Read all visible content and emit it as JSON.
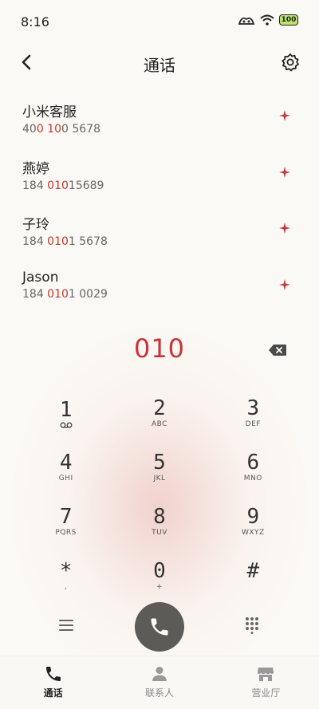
{
  "status": {
    "time": "8:16",
    "battery": "100"
  },
  "header": {
    "title": "通话"
  },
  "contacts": [
    {
      "name": "小米客服",
      "num_pre": "40",
      "num_hl": "0 10",
      "num_post": "0 5678"
    },
    {
      "name": "燕婷",
      "num_pre": "184 ",
      "num_hl": "010",
      "num_post": "15689"
    },
    {
      "name": "子玲",
      "num_pre": "184 ",
      "num_hl": "010",
      "num_post": "1 5678"
    },
    {
      "name": "Jason",
      "num_pre": "184 ",
      "num_hl": "010",
      "num_post": "1 0029"
    }
  ],
  "dialed": "010",
  "keypad": [
    {
      "digit": "1",
      "letters": ""
    },
    {
      "digit": "2",
      "letters": "ABC"
    },
    {
      "digit": "3",
      "letters": "DEF"
    },
    {
      "digit": "4",
      "letters": "GHI"
    },
    {
      "digit": "5",
      "letters": "JKL"
    },
    {
      "digit": "6",
      "letters": "MNO"
    },
    {
      "digit": "7",
      "letters": "PQRS"
    },
    {
      "digit": "8",
      "letters": "TUV"
    },
    {
      "digit": "9",
      "letters": "WXYZ"
    },
    {
      "digit": "*",
      "letters": ","
    },
    {
      "digit": "0",
      "letters": "+"
    },
    {
      "digit": "#",
      "letters": ""
    }
  ],
  "nav": [
    {
      "label": "通话",
      "icon": "phone-icon",
      "active": true
    },
    {
      "label": "联系人",
      "icon": "person-icon",
      "active": false
    },
    {
      "label": "营业厅",
      "icon": "store-icon",
      "active": false
    }
  ],
  "colors": {
    "accent": "#c8333a",
    "call_button": "#5d5b58",
    "background": "#fbf9f5"
  }
}
